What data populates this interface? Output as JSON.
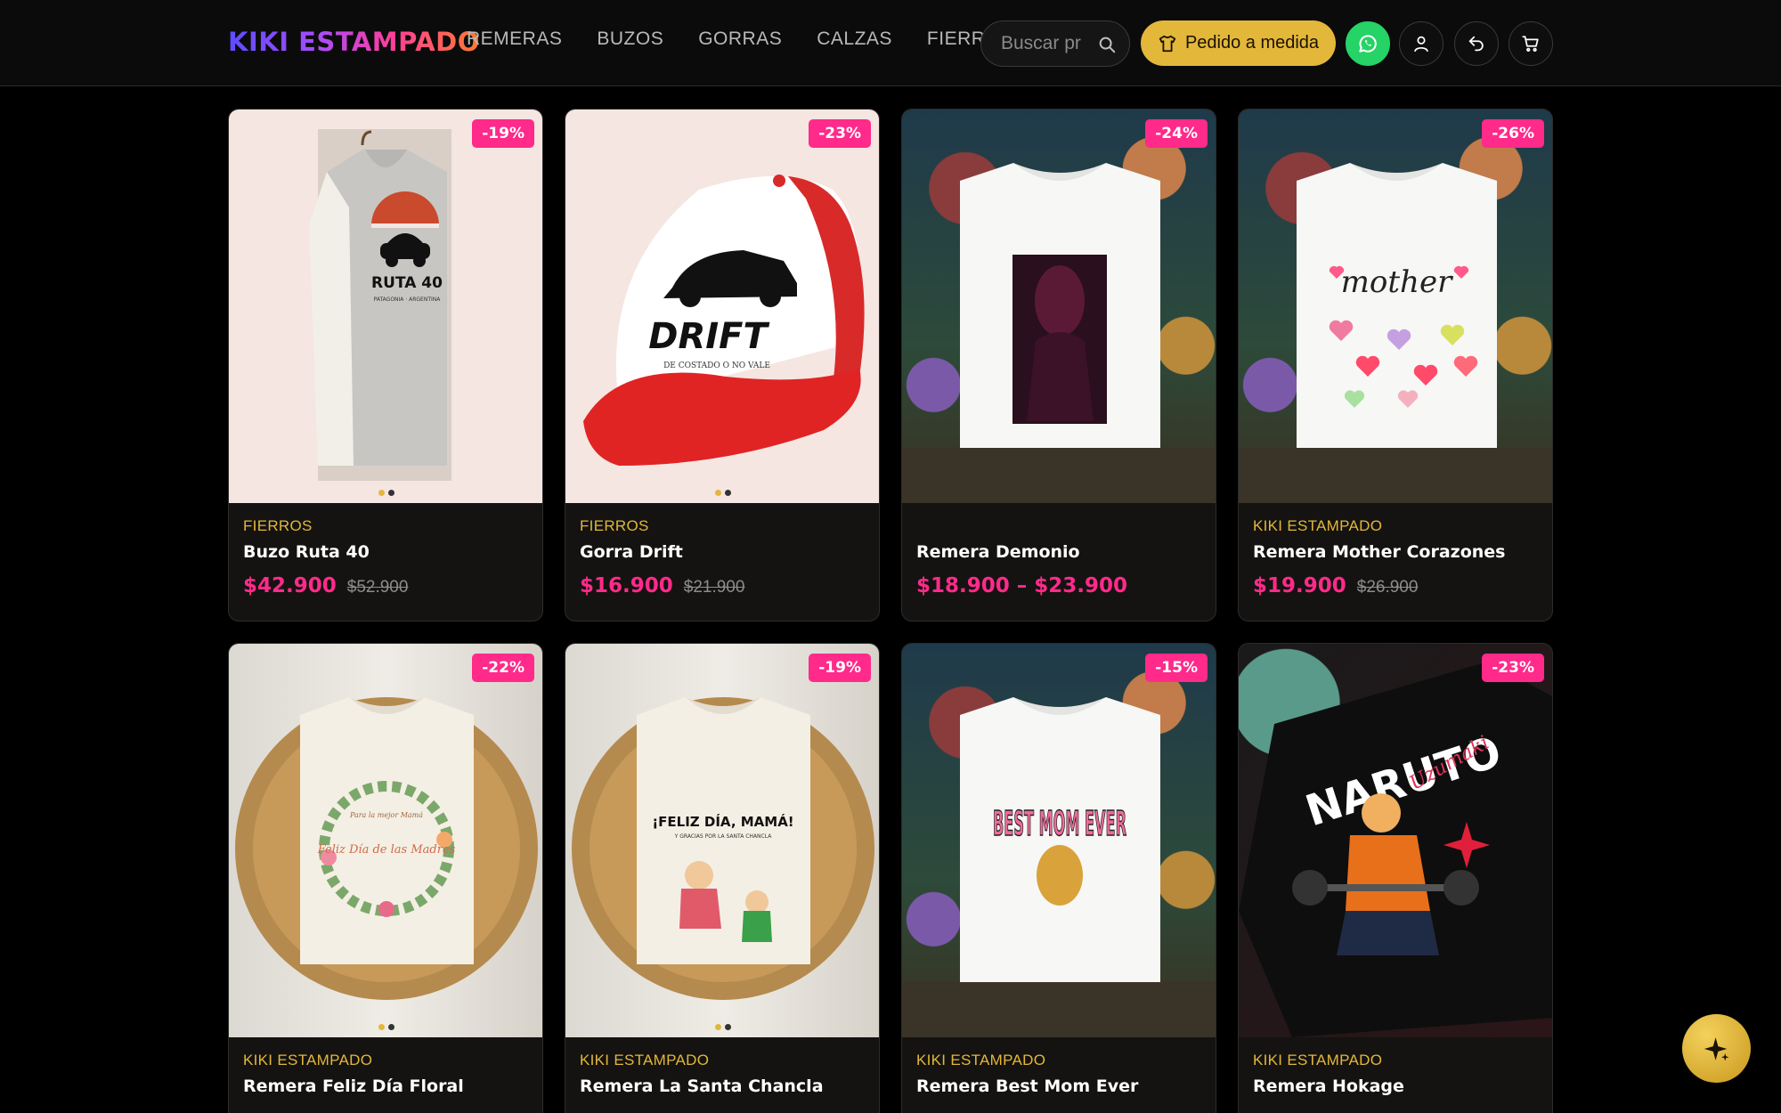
{
  "header": {
    "logo": "KIKI ESTAMPADO",
    "nav": [
      "REMERAS",
      "BUZOS",
      "GORRAS",
      "CALZAS",
      "FIERROS"
    ],
    "search_placeholder": "Buscar pr",
    "pedido_label": "Pedido a medida"
  },
  "products": [
    {
      "brand": "FIERROS",
      "title": "Buzo Ruta 40",
      "price": "$42.900",
      "old_price": "$52.900",
      "discount": "-19%",
      "image_text": "RUTA 40",
      "image_sub": "PATAGONIA · ARGENTINA"
    },
    {
      "brand": "FIERROS",
      "title": "Gorra Drift",
      "price": "$16.900",
      "old_price": "$21.900",
      "discount": "-23%",
      "image_text": "DRIFT",
      "image_sub": "DE COSTADO O NO VALE"
    },
    {
      "brand": "",
      "title": "Remera Demonio",
      "price": "$18.900 – $23.900",
      "old_price": "",
      "discount": "-24%"
    },
    {
      "brand": "KIKI ESTAMPADO",
      "title": "Remera Mother Corazones",
      "price": "$19.900",
      "old_price": "$26.900",
      "discount": "-26%",
      "image_text": "mother"
    },
    {
      "brand": "KIKI ESTAMPADO",
      "title": "Remera Feliz Día Floral",
      "price": "",
      "old_price": "",
      "discount": "-22%",
      "image_text": "Feliz Día de las Madres",
      "image_sub": "Para la mejor Mamá"
    },
    {
      "brand": "KIKI ESTAMPADO",
      "title": "Remera La Santa Chancla",
      "price": "",
      "old_price": "",
      "discount": "-19%",
      "image_text": "¡FELIZ DÍA, MAMÁ!",
      "image_sub": "Y GRACIAS POR LA SANTA CHANCLA"
    },
    {
      "brand": "KIKI ESTAMPADO",
      "title": "Remera Best Mom Ever",
      "price": "",
      "old_price": "",
      "discount": "-15%",
      "image_text": "BEST MOM EVER"
    },
    {
      "brand": "KIKI ESTAMPADO",
      "title": "Remera Hokage",
      "price": "",
      "old_price": "",
      "discount": "-23%",
      "image_text": "NARUTO",
      "image_sub": "Uzumaki"
    }
  ]
}
